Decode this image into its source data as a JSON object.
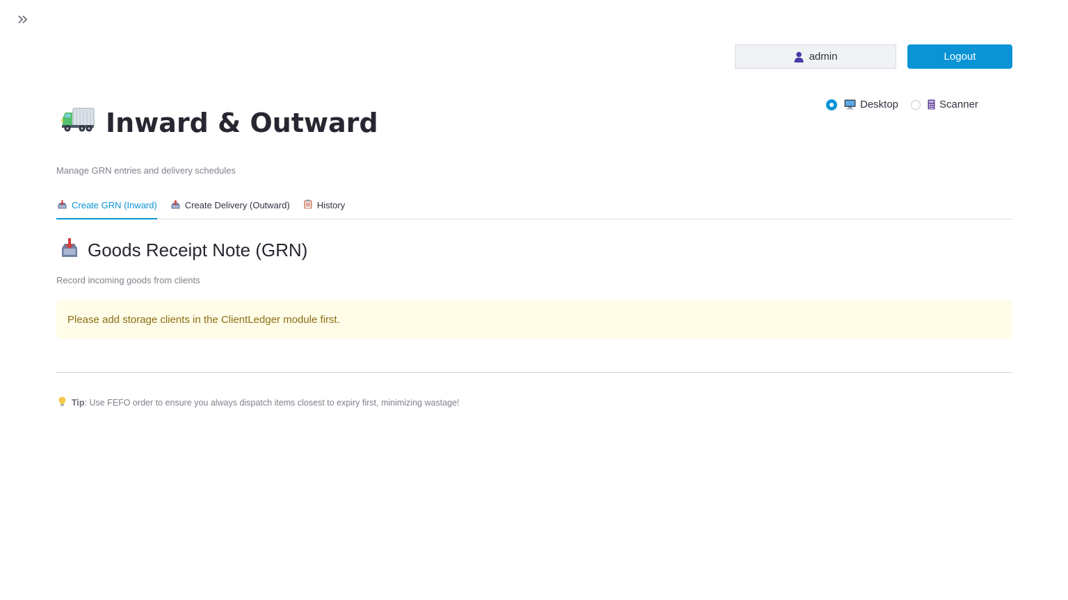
{
  "sidebar": {
    "toggle_icon": "double-chevron-right-icon"
  },
  "header": {
    "user": {
      "name": "admin",
      "icon": "user-icon"
    },
    "logout_label": "Logout"
  },
  "mode": {
    "options": [
      {
        "label": "Desktop",
        "icon": "desktop-computer-icon",
        "selected": true
      },
      {
        "label": "Scanner",
        "icon": "scanner-device-icon",
        "selected": false
      }
    ]
  },
  "page": {
    "title": "Inward & Outward",
    "title_icon": "truck-icon",
    "subtitle": "Manage GRN entries and delivery schedules"
  },
  "tabs": [
    {
      "label": "Create GRN (Inward)",
      "icon": "inbox-tray-icon",
      "active": true
    },
    {
      "label": "Create Delivery (Outward)",
      "icon": "outbox-tray-icon",
      "active": false
    },
    {
      "label": "History",
      "icon": "clipboard-icon",
      "active": false
    }
  ],
  "section": {
    "title": "Goods Receipt Note (GRN)",
    "icon": "inbox-tray-icon",
    "caption": "Record incoming goods from clients"
  },
  "warning": {
    "message": "Please add storage clients in the ClientLedger module first."
  },
  "tip": {
    "icon": "lightbulb-icon",
    "label": "Tip",
    "text": ": Use FEFO order to ensure you always dispatch items closest to expiry first, minimizing wastage!"
  },
  "colors": {
    "accent": "#0a94d6",
    "warning_bg": "#fffde7",
    "warning_text": "#8a6d14"
  }
}
